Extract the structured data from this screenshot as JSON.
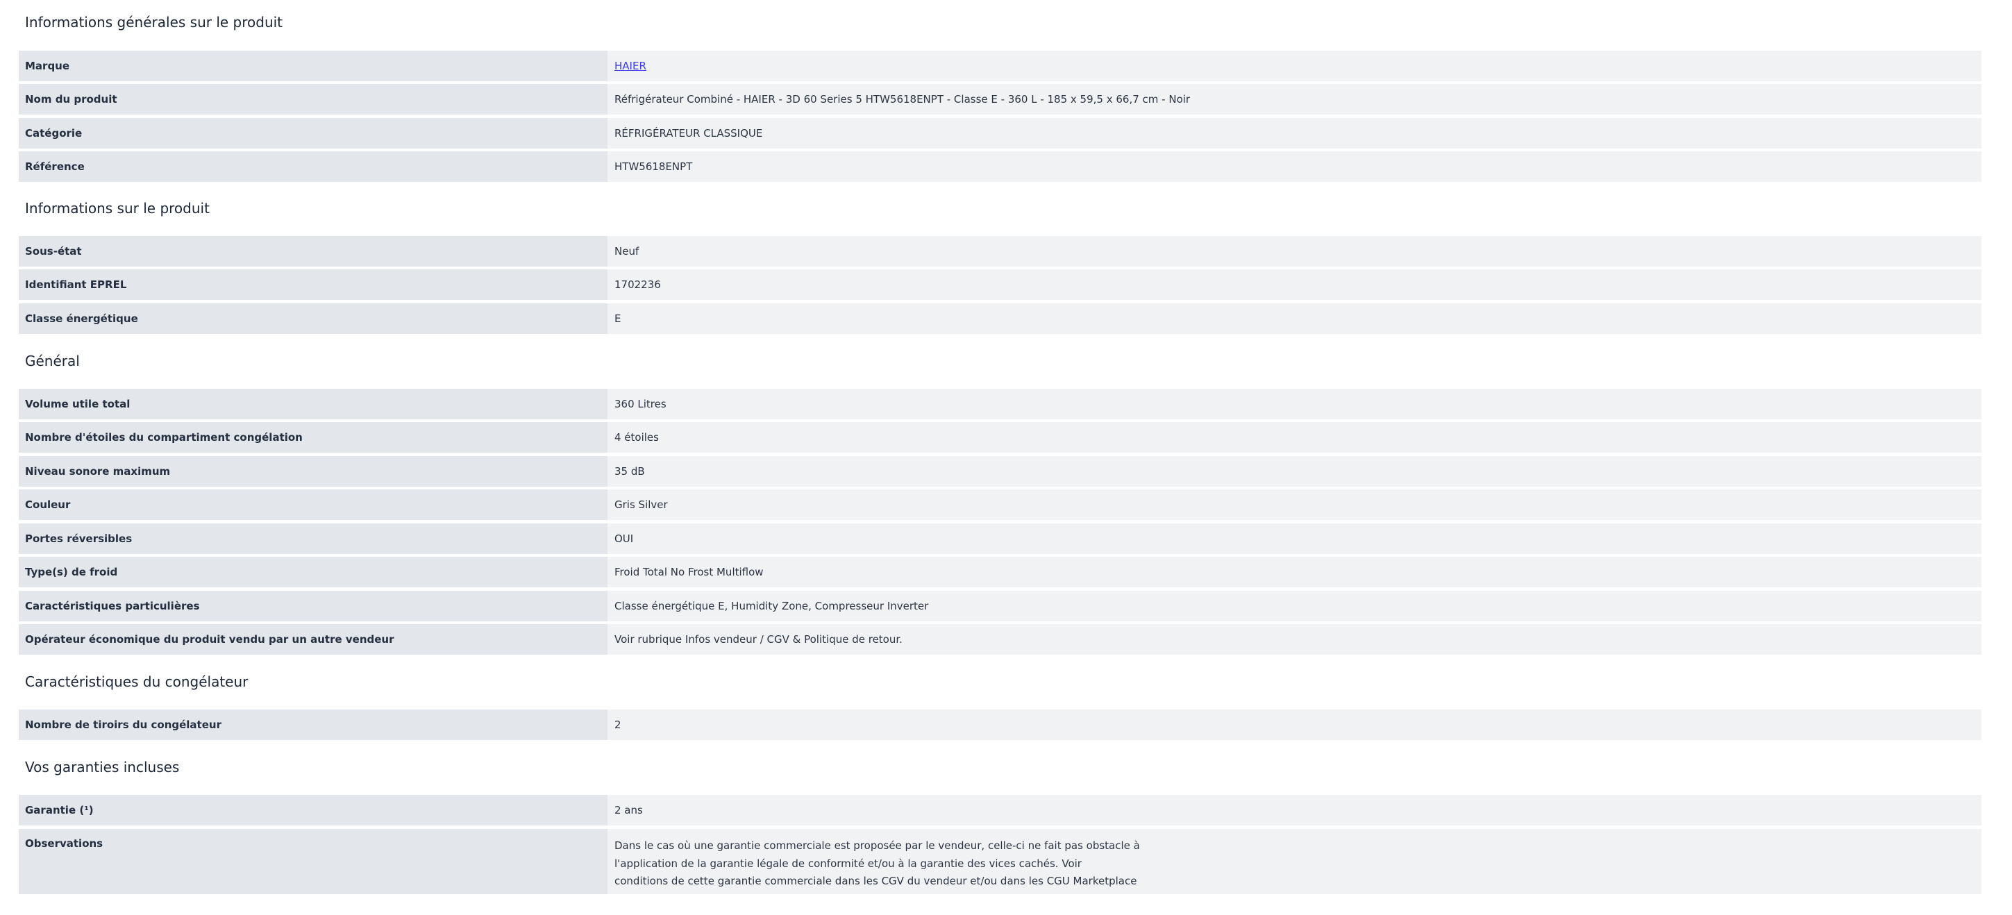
{
  "sections": {
    "general_info": {
      "title": "Informations générales sur le produit",
      "rows": [
        {
          "label": "Marque",
          "value": "HAIER"
        },
        {
          "label": "Nom du produit",
          "value": "Réfrigérateur Combiné - HAIER - 3D 60 Series 5 HTW5618ENPT - Classe E - 360 L - 185 x 59,5 x 66,7 cm - Noir"
        },
        {
          "label": "Catégorie",
          "value": "RÉFRIGÉRATEUR CLASSIQUE"
        },
        {
          "label": "Référence",
          "value": "HTW5618ENPT"
        }
      ]
    },
    "product_info": {
      "title": "Informations sur le produit",
      "rows": [
        {
          "label": "Sous-état",
          "value": "Neuf"
        },
        {
          "label": "Identifiant EPREL",
          "value": "1702236"
        },
        {
          "label": "Classe énergétique",
          "value": "E"
        }
      ]
    },
    "general": {
      "title": "Général",
      "rows": [
        {
          "label": "Volume utile total",
          "value": "360 Litres"
        },
        {
          "label": "Nombre d'étoiles du compartiment congélation",
          "value": "4 étoiles"
        },
        {
          "label": "Niveau sonore maximum",
          "value": "35 dB"
        },
        {
          "label": "Couleur",
          "value": "Gris Silver"
        },
        {
          "label": "Portes réversibles",
          "value": "OUI"
        },
        {
          "label": "Type(s) de froid",
          "value": "Froid Total No Frost Multiflow"
        },
        {
          "label": "Caractéristiques particulières",
          "value": "Classe énergétique E, Humidity Zone, Compresseur Inverter"
        },
        {
          "label": "Opérateur économique du produit vendu par un autre vendeur",
          "value": "Voir rubrique Infos vendeur / CGV & Politique de retour."
        }
      ]
    },
    "freezer": {
      "title": "Caractéristiques du congélateur",
      "rows": [
        {
          "label": "Nombre de tiroirs du congélateur",
          "value": "2"
        }
      ]
    },
    "warranty": {
      "title": "Vos garanties incluses",
      "rows": [
        {
          "label": "Garantie (¹)",
          "value": "2 ans"
        },
        {
          "label": "Observations",
          "lines": [
            "Dans le cas où une garantie commerciale est proposée par le vendeur, celle-ci ne fait pas obstacle à",
            "l'application de la garantie légale de conformité et/ou à la garantie des vices cachés. Voir",
            "conditions de cette garantie commerciale dans les CGV du vendeur et/ou dans les CGU Marketplace"
          ]
        }
      ]
    }
  },
  "colors": {
    "label_bg": "#e3e6ea",
    "value_bg": "#f1f2f4",
    "link": "#3b3bf0",
    "text": "#1e2a3b"
  }
}
